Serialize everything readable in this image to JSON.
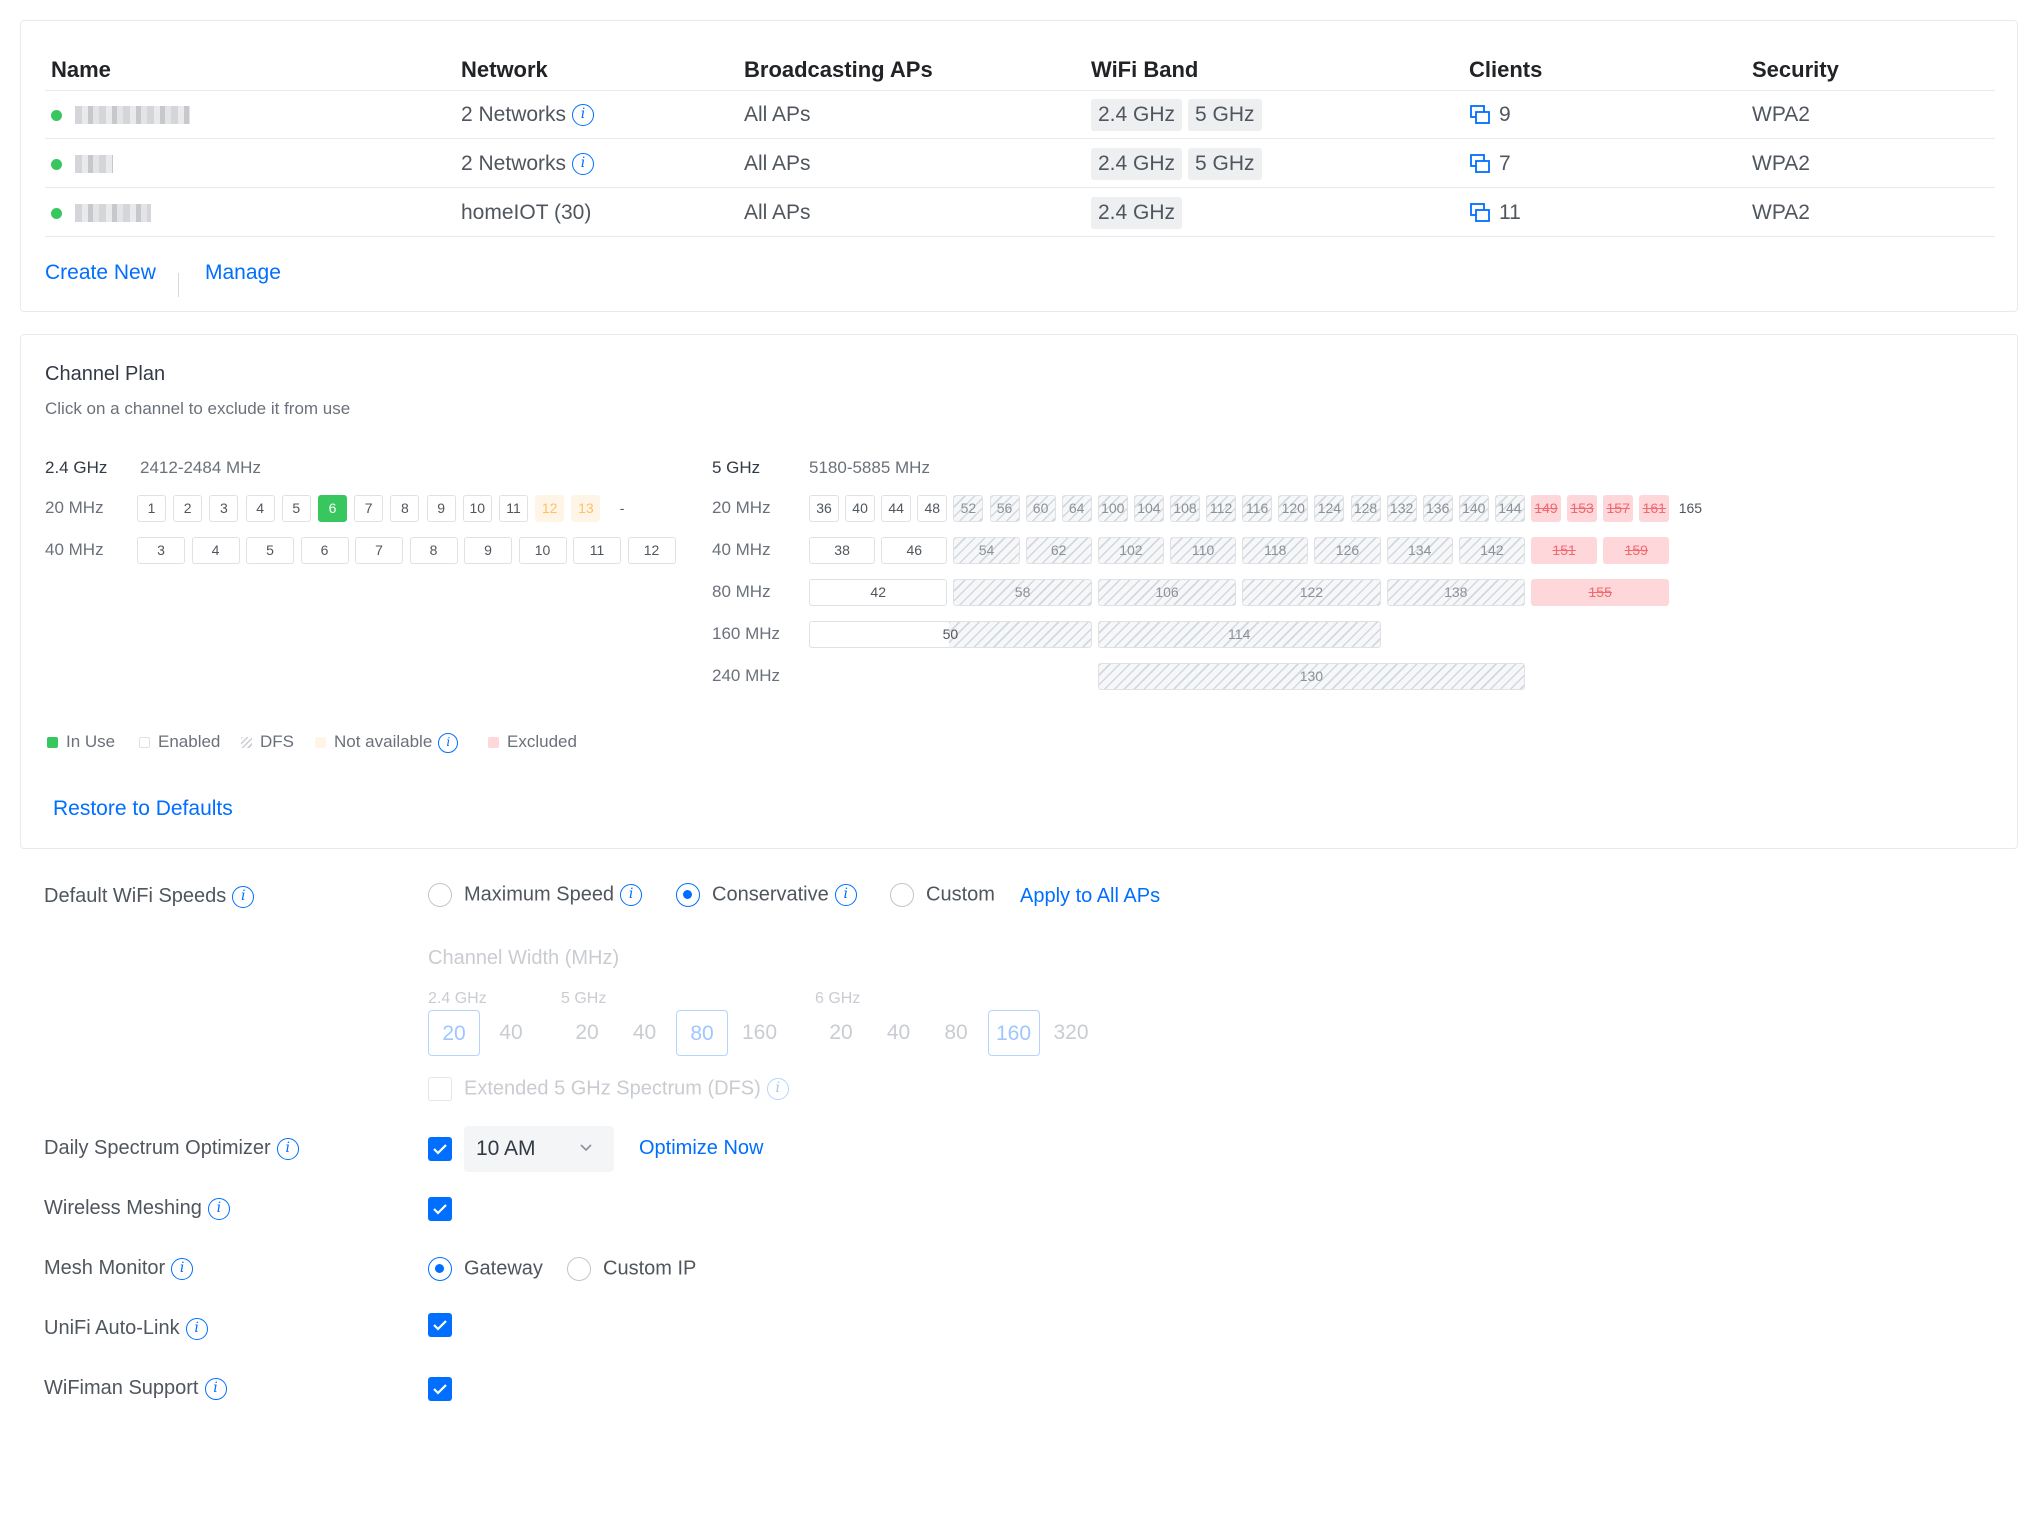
{
  "table": {
    "headers": {
      "name": "Name",
      "network": "Network",
      "broadcasting": "Broadcasting APs",
      "band": "WiFi Band",
      "clients": "Clients",
      "security": "Security"
    },
    "rows": [
      {
        "network": "2 Networks",
        "network_info": true,
        "broadcasting": "All APs",
        "bands": [
          "2.4 GHz",
          "5 GHz"
        ],
        "clients": "9",
        "security": "WPA2",
        "status_color": "#38c75e"
      },
      {
        "network": "2 Networks",
        "network_info": true,
        "broadcasting": "All APs",
        "bands": [
          "2.4 GHz",
          "5 GHz"
        ],
        "clients": "7",
        "security": "WPA2",
        "status_color": "#38c75e"
      },
      {
        "network": "homeIOT (30)",
        "network_info": false,
        "broadcasting": "All APs",
        "bands": [
          "2.4 GHz"
        ],
        "clients": "11",
        "security": "WPA2",
        "status_color": "#38c75e"
      }
    ],
    "create_new": "Create New",
    "manage": "Manage"
  },
  "channel_plan": {
    "title": "Channel Plan",
    "subtitle": "Click on a channel to exclude it from use",
    "band24": {
      "label": "2.4 GHz",
      "range": "2412-2484 MHz",
      "w20_label": "20 MHz",
      "w20": [
        {
          "n": "1",
          "s": "enabled"
        },
        {
          "n": "2",
          "s": "enabled"
        },
        {
          "n": "3",
          "s": "enabled"
        },
        {
          "n": "4",
          "s": "enabled"
        },
        {
          "n": "5",
          "s": "enabled"
        },
        {
          "n": "6",
          "s": "inuse"
        },
        {
          "n": "7",
          "s": "enabled"
        },
        {
          "n": "8",
          "s": "enabled"
        },
        {
          "n": "9",
          "s": "enabled"
        },
        {
          "n": "10",
          "s": "enabled"
        },
        {
          "n": "11",
          "s": "enabled"
        },
        {
          "n": "12",
          "s": "na"
        },
        {
          "n": "13",
          "s": "na"
        },
        {
          "n": "-",
          "s": "plain"
        }
      ],
      "w40_label": "40 MHz",
      "w40": [
        "3",
        "4",
        "5",
        "6",
        "7",
        "8",
        "9",
        "10",
        "11",
        "12"
      ]
    },
    "band5": {
      "label": "5 GHz",
      "range": "5180-5885 MHz",
      "w20_label": "20 MHz",
      "w20": [
        {
          "n": "36",
          "s": "enabled"
        },
        {
          "n": "40",
          "s": "enabled"
        },
        {
          "n": "44",
          "s": "enabled"
        },
        {
          "n": "48",
          "s": "enabled"
        },
        {
          "n": "52",
          "s": "dfs"
        },
        {
          "n": "56",
          "s": "dfs"
        },
        {
          "n": "60",
          "s": "dfs"
        },
        {
          "n": "64",
          "s": "dfs"
        },
        {
          "n": "100",
          "s": "dfs"
        },
        {
          "n": "104",
          "s": "dfs"
        },
        {
          "n": "108",
          "s": "dfs"
        },
        {
          "n": "112",
          "s": "dfs"
        },
        {
          "n": "116",
          "s": "dfs"
        },
        {
          "n": "120",
          "s": "dfs"
        },
        {
          "n": "124",
          "s": "dfs"
        },
        {
          "n": "128",
          "s": "dfs"
        },
        {
          "n": "132",
          "s": "dfs"
        },
        {
          "n": "136",
          "s": "dfs"
        },
        {
          "n": "140",
          "s": "dfs"
        },
        {
          "n": "144",
          "s": "dfs"
        },
        {
          "n": "149",
          "s": "excl"
        },
        {
          "n": "153",
          "s": "excl"
        },
        {
          "n": "157",
          "s": "excl"
        },
        {
          "n": "161",
          "s": "excl"
        },
        {
          "n": "165",
          "s": "plain"
        }
      ],
      "w40_label": "40 MHz",
      "w40": [
        {
          "n": "38",
          "s": "enabled"
        },
        {
          "n": "46",
          "s": "enabled"
        },
        {
          "n": "54",
          "s": "dfs"
        },
        {
          "n": "62",
          "s": "dfs"
        },
        {
          "n": "102",
          "s": "dfs"
        },
        {
          "n": "110",
          "s": "dfs"
        },
        {
          "n": "118",
          "s": "dfs"
        },
        {
          "n": "126",
          "s": "dfs"
        },
        {
          "n": "134",
          "s": "dfs"
        },
        {
          "n": "142",
          "s": "dfs"
        },
        {
          "n": "151",
          "s": "excl"
        },
        {
          "n": "159",
          "s": "excl"
        }
      ],
      "w80_label": "80 MHz",
      "w80": [
        {
          "n": "42",
          "s": "enabled"
        },
        {
          "n": "58",
          "s": "dfs"
        },
        {
          "n": "106",
          "s": "dfs"
        },
        {
          "n": "122",
          "s": "dfs"
        },
        {
          "n": "138",
          "s": "dfs"
        },
        {
          "n": "155",
          "s": "excl"
        }
      ],
      "w160_label": "160 MHz",
      "w160": [
        {
          "n": "50",
          "s": "mixed"
        },
        {
          "n": "114",
          "s": "dfs"
        }
      ],
      "w240_label": "240 MHz",
      "w240": [
        {
          "n": "130",
          "s": "dfs"
        }
      ]
    },
    "legend": {
      "inuse": "In Use",
      "enabled": "Enabled",
      "dfs": "DFS",
      "na": "Not available",
      "excluded": "Excluded"
    },
    "colors": {
      "inuse": "#38c75e",
      "na": "#fff5e6",
      "excluded": "#fdd7d9"
    },
    "restore": "Restore to Defaults"
  },
  "settings": {
    "default_speeds": {
      "label": "Default WiFi Speeds",
      "options": [
        "Maximum Speed",
        "Conservative",
        "Custom"
      ],
      "selected": "Conservative",
      "apply": "Apply to All APs",
      "channel_width_label": "Channel Width (MHz)",
      "g24": {
        "label": "2.4 GHz",
        "values": [
          "20",
          "40"
        ],
        "selected": "20"
      },
      "g5": {
        "label": "5 GHz",
        "values": [
          "20",
          "40",
          "80",
          "160"
        ],
        "selected": "80"
      },
      "g6": {
        "label": "6 GHz",
        "values": [
          "20",
          "40",
          "80",
          "160",
          "320"
        ],
        "selected": "160"
      },
      "dfs_label": "Extended 5 GHz Spectrum (DFS)"
    },
    "optimizer": {
      "label": "Daily Spectrum Optimizer",
      "time": "10 AM",
      "action": "Optimize Now",
      "checked": true
    },
    "meshing": {
      "label": "Wireless Meshing",
      "checked": true
    },
    "mesh_monitor": {
      "label": "Mesh Monitor",
      "options": [
        "Gateway",
        "Custom IP"
      ],
      "selected": "Gateway"
    },
    "autolink": {
      "label": "UniFi Auto-Link",
      "checked": true
    },
    "wifiman": {
      "label": "WiFiman Support",
      "checked": true
    }
  },
  "accent_color": "#006fff"
}
